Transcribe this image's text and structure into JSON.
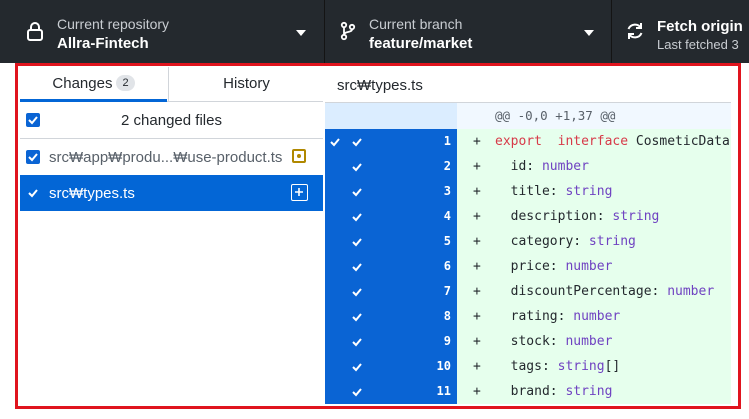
{
  "toolbar": {
    "repo": {
      "label": "Current repository",
      "value": "Allra-Fintech",
      "icon": "lock-icon"
    },
    "branch": {
      "label": "Current branch",
      "value": "feature/market",
      "icon": "branch-icon"
    },
    "fetch": {
      "label": "Fetch origin",
      "sub": "Last fetched 3",
      "icon": "sync-icon"
    }
  },
  "left": {
    "tabs": {
      "changes": "Changes",
      "changes_count": "2",
      "history": "History"
    },
    "changed_summary": "2 changed files",
    "files": [
      {
        "path": "src₩app₩produ...₩use-product.ts",
        "status": "modified",
        "selected": false
      },
      {
        "path": "src₩types.ts",
        "status": "added",
        "selected": true
      }
    ]
  },
  "right": {
    "path": "src₩types.ts",
    "hunk": "@@ -0,0 +1,37 @@",
    "lines": [
      {
        "num": "1",
        "parts": [
          [
            "kw",
            "export"
          ],
          [
            "",
            "  "
          ],
          [
            "kw",
            "interface"
          ],
          [
            "",
            " CosmeticData {"
          ]
        ]
      },
      {
        "num": "2",
        "parts": [
          [
            "",
            "  id: "
          ],
          [
            "ty",
            "number"
          ]
        ]
      },
      {
        "num": "3",
        "parts": [
          [
            "",
            "  title: "
          ],
          [
            "ty",
            "string"
          ]
        ]
      },
      {
        "num": "4",
        "parts": [
          [
            "",
            "  description: "
          ],
          [
            "ty",
            "string"
          ]
        ]
      },
      {
        "num": "5",
        "parts": [
          [
            "",
            "  category: "
          ],
          [
            "ty",
            "string"
          ]
        ]
      },
      {
        "num": "6",
        "parts": [
          [
            "",
            "  price: "
          ],
          [
            "ty",
            "number"
          ]
        ]
      },
      {
        "num": "7",
        "parts": [
          [
            "",
            "  discountPercentage: "
          ],
          [
            "ty",
            "number"
          ]
        ]
      },
      {
        "num": "8",
        "parts": [
          [
            "",
            "  rating: "
          ],
          [
            "ty",
            "number"
          ]
        ]
      },
      {
        "num": "9",
        "parts": [
          [
            "",
            "  stock: "
          ],
          [
            "ty",
            "number"
          ]
        ]
      },
      {
        "num": "10",
        "parts": [
          [
            "",
            "  tags: "
          ],
          [
            "ty",
            "string"
          ],
          [
            "",
            "[]"
          ]
        ]
      },
      {
        "num": "11",
        "parts": [
          [
            "",
            "  brand: "
          ],
          [
            "ty",
            "string"
          ]
        ]
      }
    ]
  },
  "colors": {
    "accent": "#0366d6",
    "added_bg": "#e6ffed",
    "highlight_frame": "#e0141e",
    "modified": "#b08800"
  }
}
